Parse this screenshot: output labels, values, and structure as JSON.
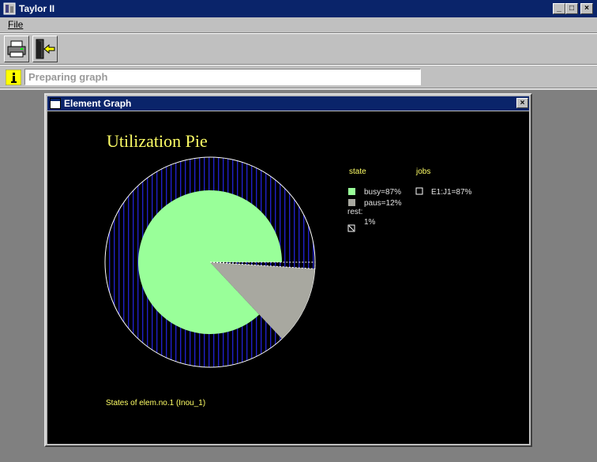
{
  "window": {
    "title": "Taylor II",
    "buttons": [
      "_",
      "□",
      "×"
    ]
  },
  "menu": {
    "file": "File"
  },
  "toolbar": {
    "print_icon": "printer-icon",
    "exit_icon": "exit-door-icon"
  },
  "status": {
    "icon": "info-icon",
    "text": "Preparing graph"
  },
  "child_window": {
    "title": "Element Graph",
    "close": "×"
  },
  "chart_data": {
    "type": "pie",
    "title": "Utilization Pie",
    "caption": "States of elem.no.1 (Inou_1)",
    "legend_state_header": "state",
    "legend_jobs_header": "jobs",
    "slices": [
      {
        "label": "busy=87%",
        "value": 87,
        "color": "#99ff99"
      },
      {
        "label": "paus=12%",
        "value": 12,
        "color": "#a8a8a0"
      },
      {
        "label": "1%",
        "value": 1,
        "color": "#ffffff"
      }
    ],
    "rest_label": "rest:",
    "jobs": [
      {
        "label": "E1:J1=87%",
        "value": 87
      }
    ]
  }
}
